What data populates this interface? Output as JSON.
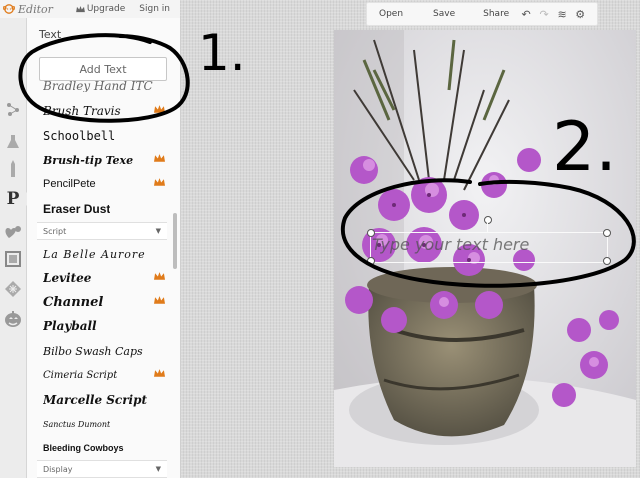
{
  "app": {
    "title": "Editor",
    "upgrade": "Upgrade",
    "signin": "Sign in"
  },
  "toolbar": {
    "open": "Open",
    "save": "Save",
    "share": "Share"
  },
  "panel": {
    "heading": "Text",
    "add_text": "Add Text",
    "fonts_top": [
      {
        "name": "Brush Travis",
        "premium": true
      },
      {
        "name": "Schoolbell",
        "premium": false
      },
      {
        "name": "Brush-tip Texe",
        "premium": true
      },
      {
        "name": "PencilPete",
        "premium": true
      },
      {
        "name": "Eraser Dust",
        "premium": false
      }
    ],
    "section_script": "Script",
    "fonts_script": [
      {
        "name": "La Belle Aurore",
        "premium": false
      },
      {
        "name": "Levitee",
        "premium": true
      },
      {
        "name": "Channel",
        "premium": true
      },
      {
        "name": "Playball",
        "premium": false
      },
      {
        "name": "Bilbo Swash Caps",
        "premium": false
      },
      {
        "name": "Cimeria Script",
        "premium": true
      },
      {
        "name": "Marcelle Script",
        "premium": false
      },
      {
        "name": "Sanctus Dumont",
        "premium": false
      },
      {
        "name": "Bleeding Cowboys",
        "premium": false
      }
    ],
    "section_display": "Display"
  },
  "canvas": {
    "placeholder": "Type your text here"
  },
  "annotations": {
    "step1": "1.",
    "step2": "2."
  },
  "colors": {
    "crown": "#e07b1a",
    "annotation": "#000000",
    "flower": "#b457c9"
  },
  "rail_icons": [
    "effects-icon",
    "touch-up-icon",
    "frames-icon",
    "text-icon",
    "stickers-icon",
    "textures-icon",
    "overlays-icon",
    "seasonal-icon"
  ]
}
